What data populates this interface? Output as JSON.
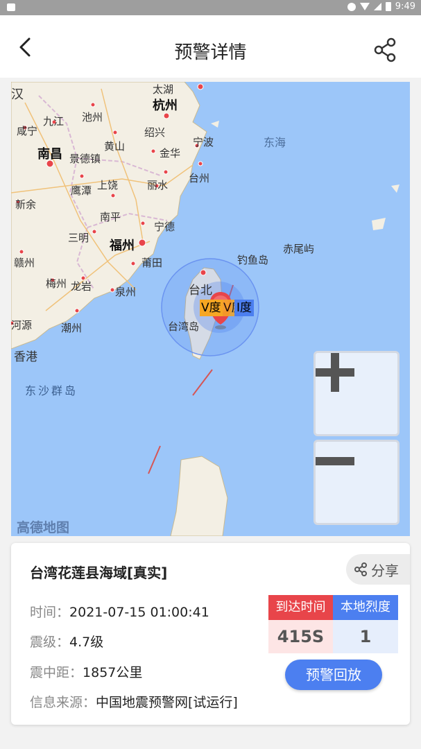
{
  "status_bar": {
    "time": "9:49"
  },
  "header": {
    "title": "预警详情",
    "back_icon": "chevron-left-icon",
    "share_icon": "share-icon"
  },
  "map": {
    "labels": {
      "han": "汉",
      "taihu": "太湖",
      "hangzhou": "杭州",
      "chizhou": "池州",
      "jiujiang": "九江",
      "xianning": "咸宁",
      "huangshan": "黄山",
      "shaoxing": "绍兴",
      "ningbo": "宁波",
      "nanchang": "南昌",
      "jingdezhen": "景德镇",
      "jinhua": "金华",
      "donghai": "东海",
      "taizhou": "台州",
      "yingtan": "鹰潭",
      "shangrao": "上饶",
      "lishui": "丽水",
      "xinyu": "新余",
      "nanping": "南平",
      "ningde": "宁德",
      "sanming": "三明",
      "fuzhou": "福州",
      "ganzhou": "赣州",
      "putian": "莆田",
      "diaoyudao": "钓鱼岛",
      "chiweiyu": "赤尾屿",
      "meizhou": "梅州",
      "longyan": "龙岩",
      "quanzhou": "泉州",
      "taibei": "台北",
      "heyuan": "河源",
      "chaozhou": "潮州",
      "taiwandao": "台湾岛",
      "xianggang": "香港",
      "dongsha": "东沙群岛"
    },
    "marker": {
      "label_left": "V度",
      "label_mid": "V度",
      "label_right": "I度"
    },
    "zoom_in_label": "+",
    "zoom_out_label": "−",
    "logo": "高德地图"
  },
  "card": {
    "title": "台湾花莲县海域[真实]",
    "share_label": "分享",
    "time_label": "时间：",
    "time_value": "2021-07-15 01:00:41",
    "magnitude_label": "震级：",
    "magnitude_value": "4.7级",
    "distance_label": "震中距：",
    "distance_value": "1857公里",
    "source_label": "信息来源：",
    "source_value": "中国地震预警网[试运行]",
    "arrival_header": "到达时间",
    "arrival_value": "415S",
    "intensity_header": "本地烈度",
    "intensity_value": "1",
    "replay_label": "预警回放"
  },
  "colors": {
    "accent_blue": "#4c7ff0",
    "alert_red": "#e8454a",
    "sea": "#9cc6f9",
    "land": "#f3efe4"
  }
}
